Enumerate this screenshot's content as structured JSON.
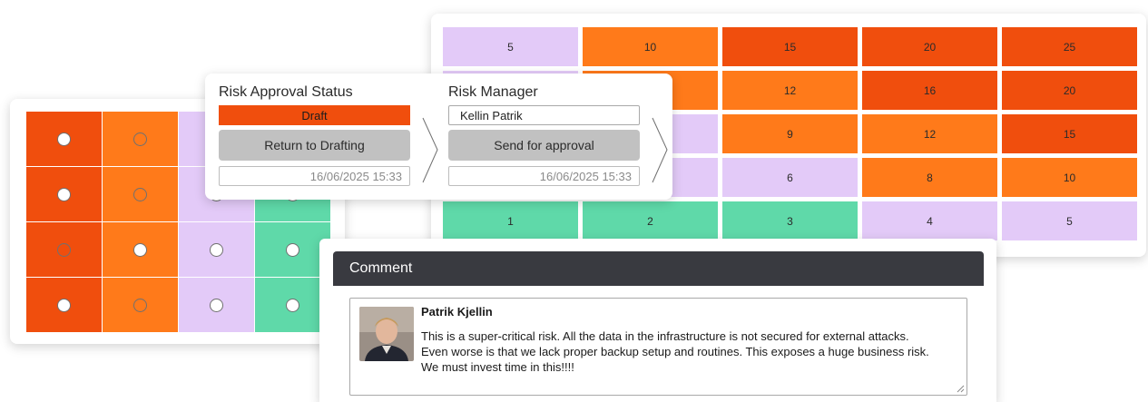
{
  "colors": {
    "red": "#f04e0d",
    "orange": "#ff7a1a",
    "purple": "#e3caf8",
    "green": "#5fd9a9",
    "draft": "#f04e0d",
    "header_dark": "#393a40"
  },
  "score_matrix": {
    "rows": [
      [
        {
          "v": "5",
          "c": "purple"
        },
        {
          "v": "10",
          "c": "orange"
        },
        {
          "v": "15",
          "c": "red"
        },
        {
          "v": "20",
          "c": "red"
        },
        {
          "v": "25",
          "c": "red"
        }
      ],
      [
        {
          "v": "",
          "c": "purple"
        },
        {
          "v": "",
          "c": "orange"
        },
        {
          "v": "12",
          "c": "orange"
        },
        {
          "v": "16",
          "c": "red"
        },
        {
          "v": "20",
          "c": "red"
        }
      ],
      [
        {
          "v": "",
          "c": "purple"
        },
        {
          "v": "",
          "c": "purple"
        },
        {
          "v": "9",
          "c": "orange"
        },
        {
          "v": "12",
          "c": "orange"
        },
        {
          "v": "15",
          "c": "red"
        }
      ],
      [
        {
          "v": "",
          "c": "purple"
        },
        {
          "v": "",
          "c": "purple"
        },
        {
          "v": "6",
          "c": "purple"
        },
        {
          "v": "8",
          "c": "orange"
        },
        {
          "v": "10",
          "c": "orange"
        }
      ],
      [
        {
          "v": "1",
          "c": "green"
        },
        {
          "v": "2",
          "c": "green"
        },
        {
          "v": "3",
          "c": "green"
        },
        {
          "v": "4",
          "c": "purple"
        },
        {
          "v": "5",
          "c": "purple"
        }
      ]
    ]
  },
  "radio_matrix": {
    "rows": [
      [
        {
          "c": "red",
          "sel": false
        },
        {
          "c": "orange",
          "sel": true
        },
        {
          "c": "purple",
          "sel": false
        },
        {
          "c": "green",
          "sel": false
        }
      ],
      [
        {
          "c": "red",
          "sel": false
        },
        {
          "c": "orange",
          "sel": true
        },
        {
          "c": "purple",
          "sel": false
        },
        {
          "c": "green",
          "sel": false
        }
      ],
      [
        {
          "c": "red",
          "sel": true
        },
        {
          "c": "orange",
          "sel": false
        },
        {
          "c": "purple",
          "sel": false
        },
        {
          "c": "green",
          "sel": false
        }
      ],
      [
        {
          "c": "red",
          "sel": false
        },
        {
          "c": "orange",
          "sel": true
        },
        {
          "c": "purple",
          "sel": false
        },
        {
          "c": "green",
          "sel": false
        }
      ]
    ]
  },
  "approval": {
    "status_title": "Risk Approval Status",
    "status_value": "Draft",
    "return_button": "Return to Drafting",
    "status_date": "16/06/2025 15:33",
    "manager_title": "Risk Manager",
    "manager_name": "Kellin Patrik",
    "send_button": "Send for approval",
    "manager_date": "16/06/2025 15:33"
  },
  "comment": {
    "header": "Comment",
    "author": "Patrik Kjellin",
    "lines": [
      "This is a super-critical risk. All the data in the infrastructure is not secured for external attacks.",
      "Even worse is that we lack proper backup setup and routines. This exposes a huge business risk.",
      "We must invest time in this!!!!"
    ]
  }
}
